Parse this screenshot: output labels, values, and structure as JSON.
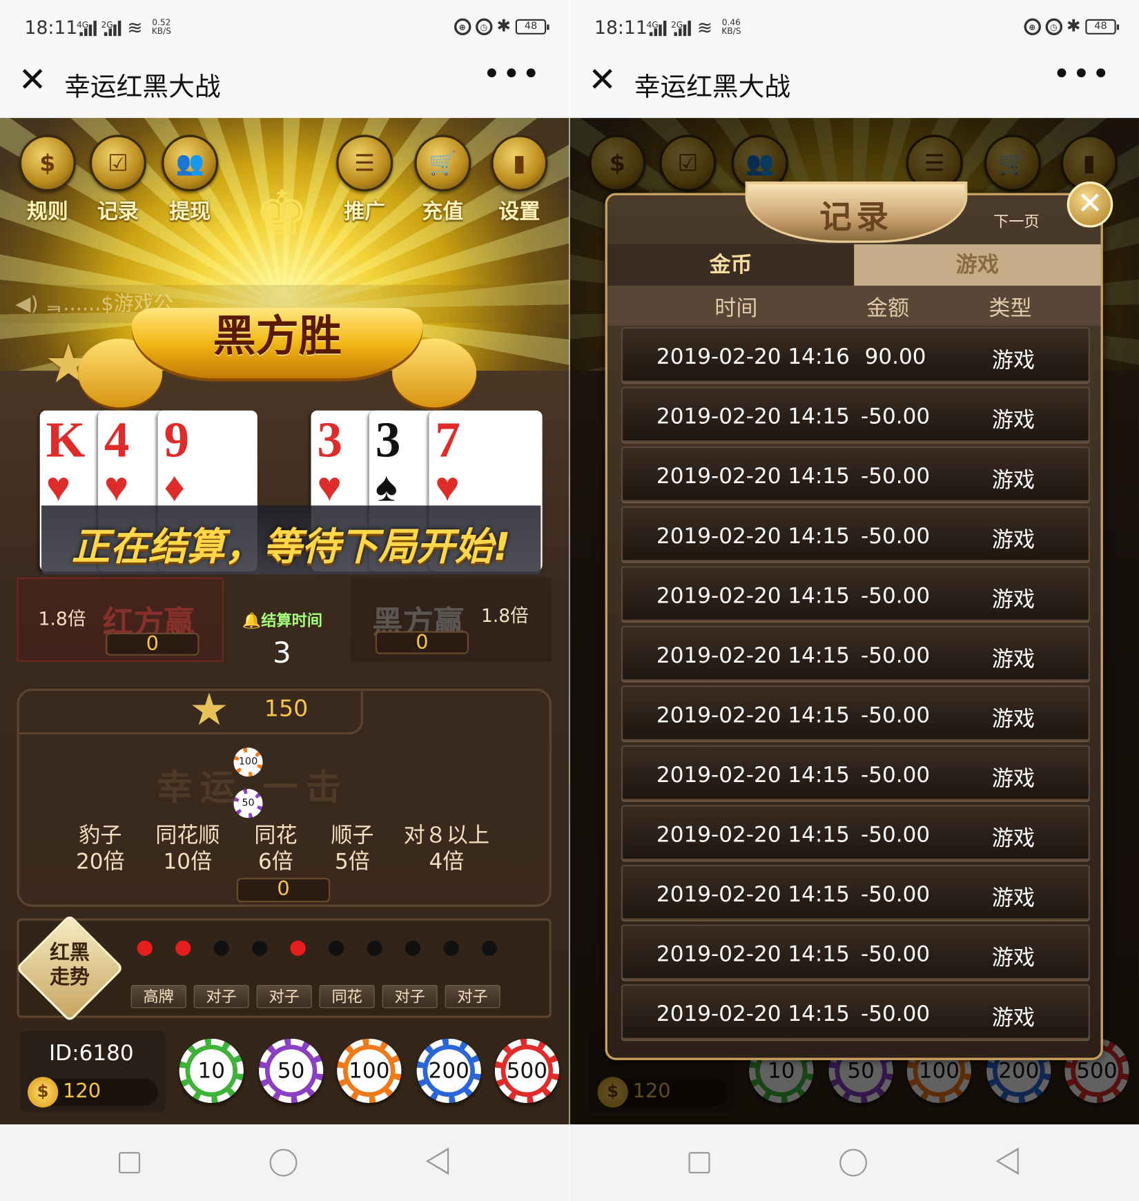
{
  "screens": [
    {
      "status": {
        "time": "18:11",
        "net1": "4G",
        "net2": "2G",
        "speed1": "0.52",
        "speed2": "KB/S",
        "battery": "48"
      },
      "titlebar": {
        "title": "幸运红黑大战",
        "close": "✕",
        "more": "•••"
      }
    },
    {
      "status": {
        "time": "18:11",
        "net1": "4G",
        "net2": "2G",
        "speed1": "0.46",
        "speed2": "KB/S",
        "battery": "48"
      },
      "titlebar": {
        "title": "幸运红黑大战",
        "close": "✕",
        "more": "•••"
      }
    }
  ],
  "top_menu": [
    {
      "label": "规则",
      "icon": "house-dollar-icon",
      "glyph": "$"
    },
    {
      "label": "记录",
      "icon": "calendar-check-icon",
      "glyph": "☑"
    },
    {
      "label": "提现",
      "icon": "users-icon",
      "glyph": "👥"
    },
    {
      "label": "推广",
      "icon": "list-icon",
      "glyph": "☰"
    },
    {
      "label": "充值",
      "icon": "cart-icon",
      "glyph": "🛒"
    },
    {
      "label": "设置",
      "icon": "ranking-icon",
      "glyph": "▮"
    }
  ],
  "notice": "ᆿ......$游戏公",
  "result_banner": "黑方胜",
  "cards": [
    {
      "rank": "K",
      "suit": "♥",
      "color": "red"
    },
    {
      "rank": "4",
      "suit": "♥",
      "color": "red"
    },
    {
      "rank": "9",
      "suit": "♦",
      "color": "red"
    },
    {
      "rank": "3",
      "suit": "♥",
      "color": "red"
    },
    {
      "rank": "3",
      "suit": "♠",
      "color": "black"
    },
    {
      "rank": "7",
      "suit": "♥",
      "color": "red"
    }
  ],
  "settle_message": "正在结算，等待下局开始!",
  "red_side": {
    "multiplier": "1.8倍",
    "label": "红方赢",
    "bet": "0"
  },
  "black_side": {
    "multiplier": "1.8倍",
    "label": "黑方赢",
    "bet": "0"
  },
  "timer": {
    "label": "结算时间",
    "value": "3"
  },
  "lucky_pool": {
    "value": "150",
    "watermark": "幸运  一击",
    "chips": [
      "100",
      "50"
    ]
  },
  "payouts": [
    {
      "name": "豹子",
      "mult": "20倍"
    },
    {
      "name": "同花顺",
      "mult": "10倍"
    },
    {
      "name": "同花",
      "mult": "6倍"
    },
    {
      "name": "顺子",
      "mult": "5倍"
    },
    {
      "name": "对８以上",
      "mult": "4倍"
    }
  ],
  "lucky_bet": "0",
  "trend": {
    "badge_line1": "红黑",
    "badge_line2": "走势",
    "dots": [
      "red",
      "red",
      "black",
      "black",
      "red",
      "black",
      "black",
      "black",
      "black",
      "black"
    ],
    "tags": [
      "高牌",
      "对子",
      "对子",
      "同花",
      "对子",
      "对子"
    ]
  },
  "player": {
    "id": "ID:6180",
    "coins": "120",
    "coin_icon": "$"
  },
  "chips": [
    {
      "value": "10",
      "color": "#3fb23a"
    },
    {
      "value": "50",
      "color": "#8a3fc4"
    },
    {
      "value": "100",
      "color": "#f07a1a"
    },
    {
      "value": "200",
      "color": "#2a66d8"
    },
    {
      "value": "500",
      "color": "#e02b2b"
    }
  ],
  "records": {
    "title": "记录",
    "next": "下一页",
    "close": "✕",
    "tabs": {
      "coins": "金币",
      "game": "游戏"
    },
    "columns": {
      "time": "时间",
      "amount": "金额",
      "type": "类型"
    },
    "rows": [
      {
        "time": "2019-02-20 14:16",
        "amount": "90.00",
        "type": "游戏"
      },
      {
        "time": "2019-02-20 14:15",
        "amount": "-50.00",
        "type": "游戏"
      },
      {
        "time": "2019-02-20 14:15",
        "amount": "-50.00",
        "type": "游戏"
      },
      {
        "time": "2019-02-20 14:15",
        "amount": "-50.00",
        "type": "游戏"
      },
      {
        "time": "2019-02-20 14:15",
        "amount": "-50.00",
        "type": "游戏"
      },
      {
        "time": "2019-02-20 14:15",
        "amount": "-50.00",
        "type": "游戏"
      },
      {
        "time": "2019-02-20 14:15",
        "amount": "-50.00",
        "type": "游戏"
      },
      {
        "time": "2019-02-20 14:15",
        "amount": "-50.00",
        "type": "游戏"
      },
      {
        "time": "2019-02-20 14:15",
        "amount": "-50.00",
        "type": "游戏"
      },
      {
        "time": "2019-02-20 14:15",
        "amount": "-50.00",
        "type": "游戏"
      },
      {
        "time": "2019-02-20 14:15",
        "amount": "-50.00",
        "type": "游戏"
      },
      {
        "time": "2019-02-20 14:15",
        "amount": "-50.00",
        "type": "游戏"
      }
    ]
  }
}
